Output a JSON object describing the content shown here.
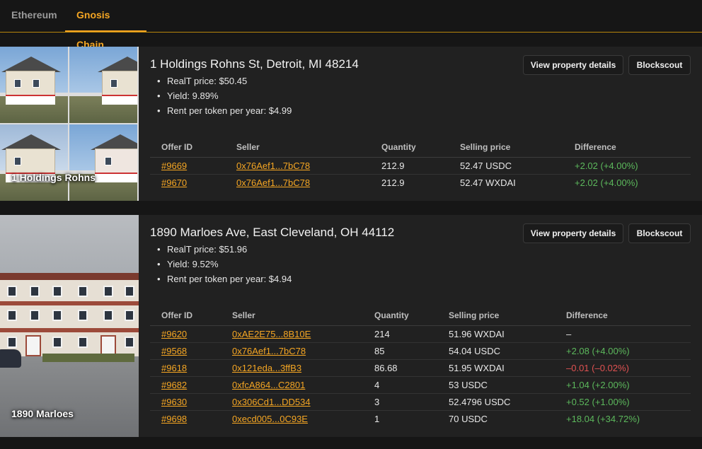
{
  "tabs": [
    {
      "label": "Ethereum",
      "active": false
    },
    {
      "label": "Gnosis Chain",
      "active": true
    }
  ],
  "colors": {
    "accent": "#f5a623",
    "positive": "#5cb85c",
    "negative": "#e05252"
  },
  "properties": [
    {
      "title": "1 Holdings Rohns St, Detroit, MI 48214",
      "thumb_label": "1 Holdings Rohns",
      "price": "RealT price: $50.45",
      "yield": "Yield: 9.89%",
      "rent": "Rent per token per year: $4.99",
      "details_button": "View property details",
      "blockscout_button": "Blockscout",
      "columns": [
        "Offer ID",
        "Seller",
        "Quantity",
        "Selling price",
        "Difference"
      ],
      "offers": [
        {
          "id": "#9669",
          "seller": "0x76Aef1...7bC78",
          "quantity": "212.9",
          "price": "52.47 USDC",
          "difference": "+2.02 (+4.00%)",
          "trend": "pos"
        },
        {
          "id": "#9670",
          "seller": "0x76Aef1...7bC78",
          "quantity": "212.9",
          "price": "52.47 WXDAI",
          "difference": "+2.02 (+4.00%)",
          "trend": "pos"
        }
      ]
    },
    {
      "title": "1890 Marloes Ave, East Cleveland, OH 44112",
      "thumb_label": "1890 Marloes",
      "price": "RealT price: $51.96",
      "yield": "Yield: 9.52%",
      "rent": "Rent per token per year: $4.94",
      "details_button": "View property details",
      "blockscout_button": "Blockscout",
      "columns": [
        "Offer ID",
        "Seller",
        "Quantity",
        "Selling price",
        "Difference"
      ],
      "offers": [
        {
          "id": "#9620",
          "seller": "0xAE2E75...8B10E",
          "quantity": "214",
          "price": "51.96 WXDAI",
          "difference": "–",
          "trend": "neu"
        },
        {
          "id": "#9568",
          "seller": "0x76Aef1...7bC78",
          "quantity": "85",
          "price": "54.04 USDC",
          "difference": "+2.08 (+4.00%)",
          "trend": "pos"
        },
        {
          "id": "#9618",
          "seller": "0x121eda...3ffB3",
          "quantity": "86.68",
          "price": "51.95 WXDAI",
          "difference": "–0.01 (–0.02%)",
          "trend": "neg"
        },
        {
          "id": "#9682",
          "seller": "0xfcA864...C2801",
          "quantity": "4",
          "price": "53 USDC",
          "difference": "+1.04 (+2.00%)",
          "trend": "pos"
        },
        {
          "id": "#9630",
          "seller": "0x306Cd1...DD534",
          "quantity": "3",
          "price": "52.4796 USDC",
          "difference": "+0.52 (+1.00%)",
          "trend": "pos"
        },
        {
          "id": "#9698",
          "seller": "0xecd005...0C93E",
          "quantity": "1",
          "price": "70 USDC",
          "difference": "+18.04 (+34.72%)",
          "trend": "pos"
        }
      ]
    }
  ]
}
